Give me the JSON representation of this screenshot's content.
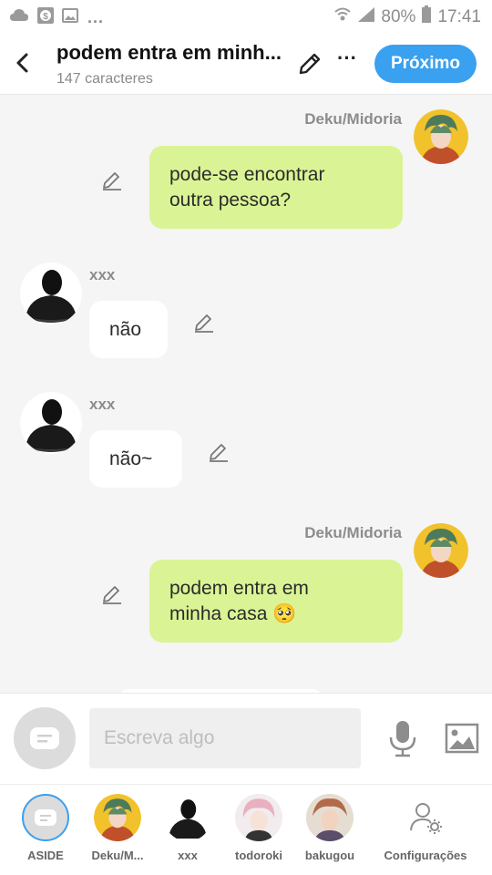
{
  "status_bar": {
    "battery_text": "80%",
    "time": "17:41"
  },
  "header": {
    "title": "podem entra em minh...",
    "subtitle": "147 caracteres",
    "next_label": "Próximo"
  },
  "messages": [
    {
      "sender": "Deku/Midoria",
      "side": "right",
      "text_line1": "pode-se encontrar",
      "text_line2": "outra pessoa?"
    },
    {
      "sender": "xxx",
      "side": "left",
      "text": "não"
    },
    {
      "sender": "xxx",
      "side": "left",
      "text": "não~"
    },
    {
      "sender": "Deku/Midoria",
      "side": "right",
      "text_line1": "podem entra em",
      "text_line2": "minha casa 🥺"
    }
  ],
  "composer": {
    "placeholder": "Escreva algo"
  },
  "characters": [
    {
      "label": "ASIDE"
    },
    {
      "label": "Deku/M..."
    },
    {
      "label": "xxx"
    },
    {
      "label": "todoroki"
    },
    {
      "label": "bakugou"
    },
    {
      "label": "Configurações"
    }
  ],
  "colors": {
    "accent": "#3aa0f0",
    "bubble_right": "#daf495",
    "bubble_left": "#ffffff",
    "background": "#f5f5f5"
  },
  "icons": {
    "back": "chevron-left-icon",
    "edit": "pencil-icon",
    "more": "more-dots-icon",
    "mic": "microphone-icon",
    "image": "image-icon",
    "settings": "user-settings-icon"
  }
}
